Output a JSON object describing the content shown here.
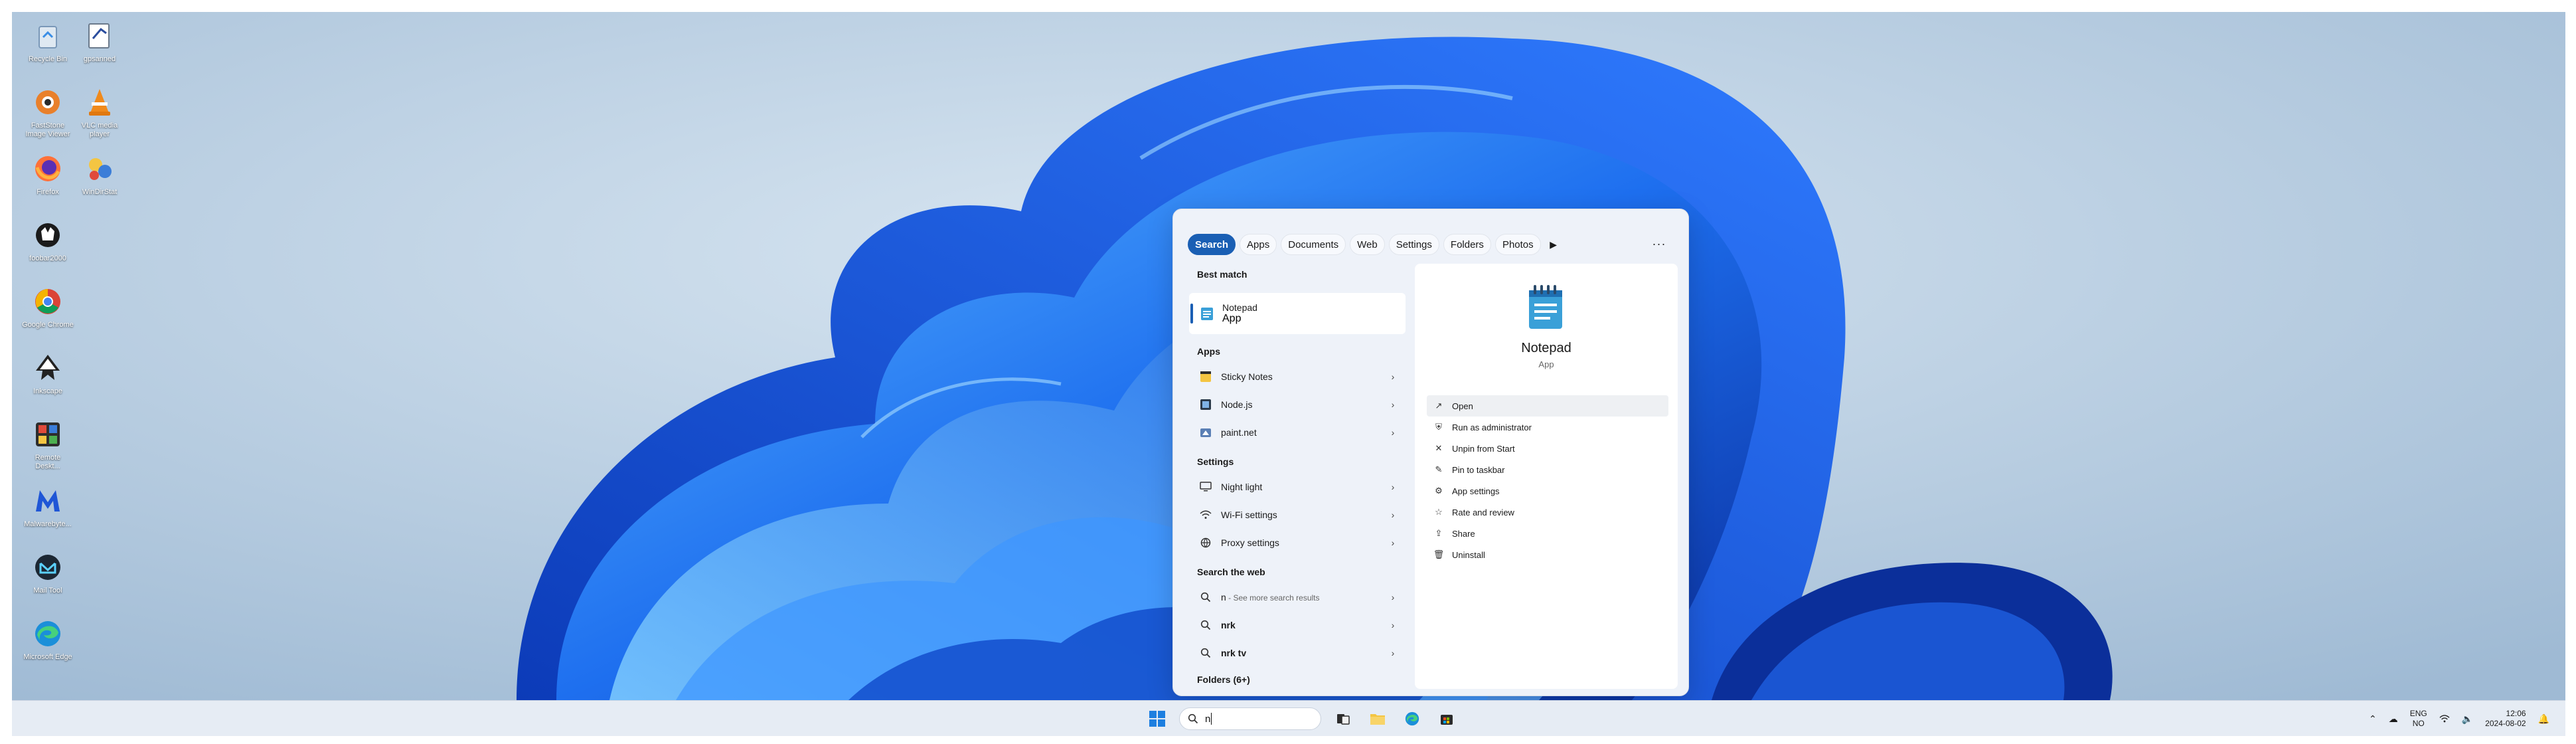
{
  "desktop": {
    "icons": [
      {
        "label": "Recycle Bin",
        "icon": "recycle-bin-icon"
      },
      {
        "label": "gpsanned",
        "icon": "document-app-icon"
      },
      {
        "label": "FastStone Image Viewer",
        "icon": "faststone-icon"
      },
      {
        "label": "VLC media player",
        "icon": "vlc-icon"
      },
      {
        "label": "Firefox",
        "icon": "firefox-icon"
      },
      {
        "label": "WinDirStat",
        "icon": "windirstat-icon"
      },
      {
        "label": "foobar2000",
        "icon": "foobar-icon"
      },
      {
        "label": "Google Chrome",
        "icon": "chrome-icon"
      },
      {
        "label": "Inkscape",
        "icon": "inkscape-icon"
      },
      {
        "label": "Remote Deskt...",
        "icon": "remote-desktop-icon"
      },
      {
        "label": "Malwarebyte...",
        "icon": "malwarebytes-icon"
      },
      {
        "label": "Mail Tool",
        "icon": "mail-tool-icon"
      },
      {
        "label": "Microsoft Edge",
        "icon": "edge-icon"
      }
    ]
  },
  "search_panel": {
    "filters": [
      "Search",
      "Apps",
      "Documents",
      "Web",
      "Settings",
      "Folders",
      "Photos"
    ],
    "active_filter": "Search",
    "more_filters_icon": "play-icon",
    "more_options_label": "···",
    "best_match": {
      "heading": "Best match",
      "name": "Notepad",
      "type": "App"
    },
    "apps": {
      "heading": "Apps",
      "items": [
        "Sticky Notes",
        "Node.js",
        "paint.net"
      ]
    },
    "settings": {
      "heading": "Settings",
      "items": [
        "Night light",
        "Wi-Fi settings",
        "Proxy settings"
      ]
    },
    "web": {
      "heading": "Search the web",
      "first_query": "n",
      "first_suffix": " - See more search results",
      "items": [
        "nrk",
        "nrk tv"
      ]
    },
    "folders": {
      "heading": "Folders (6+)"
    },
    "detail": {
      "title": "Notepad",
      "type": "App",
      "actions": [
        "Open",
        "Run as administrator",
        "Unpin from Start",
        "Pin to taskbar",
        "App settings",
        "Rate and review",
        "Share",
        "Uninstall"
      ]
    }
  },
  "taskbar": {
    "search_value": "n",
    "language": {
      "line1": "ENG",
      "line2": "NO"
    },
    "clock": {
      "time": "12:06",
      "date": "2024-08-02"
    }
  },
  "colors": {
    "accent": "#1a5fb4",
    "wallpaper_bg": "#bcd0e3",
    "bloom": "#1f6fe8"
  }
}
